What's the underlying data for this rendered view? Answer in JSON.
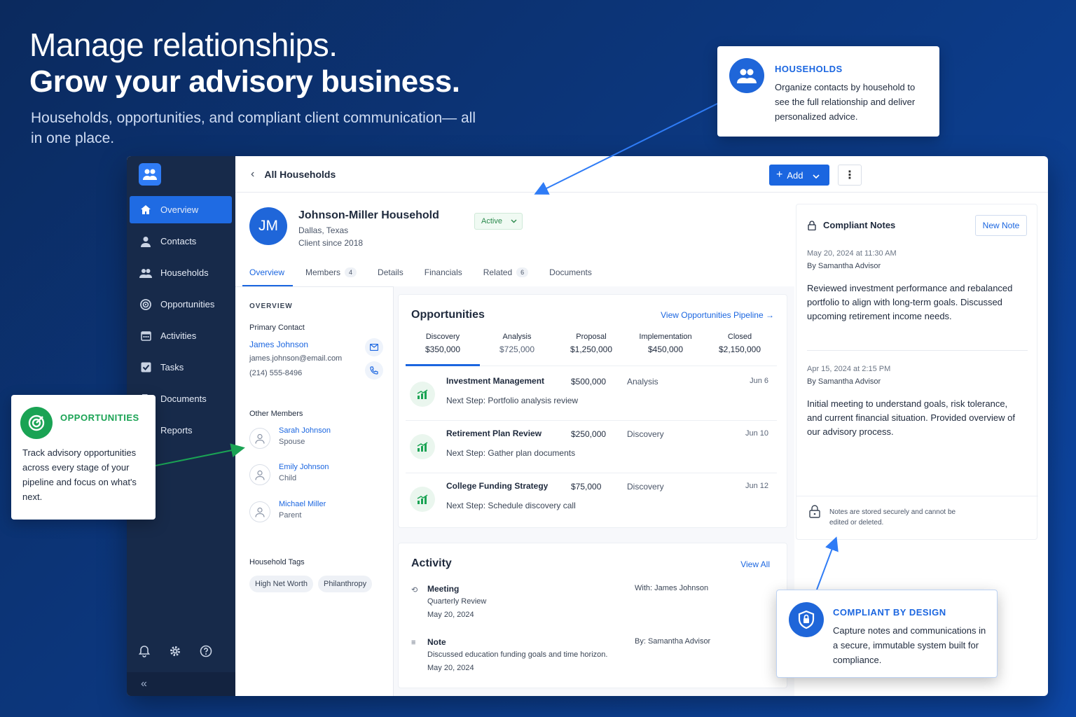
{
  "hero": {
    "line1": "Manage relationships.",
    "line2": "Grow your advisory business.",
    "subtitle": "Households, opportunities, and compliant client communication— all in one place."
  },
  "sidebar": {
    "items": [
      {
        "label": "Overview",
        "icon": "home-icon",
        "active": true
      },
      {
        "label": "Contacts",
        "icon": "person-icon"
      },
      {
        "label": "Households",
        "icon": "people-icon"
      },
      {
        "label": "Opportunities",
        "icon": "target-icon"
      },
      {
        "label": "Activities",
        "icon": "calendar-icon"
      },
      {
        "label": "Tasks",
        "icon": "checkbox-icon"
      },
      {
        "label": "Documents",
        "icon": "document-icon"
      },
      {
        "label": "Reports",
        "icon": "chart-icon"
      }
    ],
    "collapse_glyph": "«"
  },
  "topbar": {
    "breadcrumb": "All Households",
    "add_label": "Add"
  },
  "household": {
    "initials": "JM",
    "name": "Johnson-Miller Household",
    "location": "Dallas, Texas",
    "since": "Client since 2018",
    "status": "Active"
  },
  "tabs": [
    {
      "label": "Overview",
      "active": true
    },
    {
      "label": "Members",
      "badge": "4"
    },
    {
      "label": "Details"
    },
    {
      "label": "Financials"
    },
    {
      "label": "Related",
      "badge": "6"
    },
    {
      "label": "Documents"
    }
  ],
  "overview": {
    "heading": "OVERVIEW",
    "primary_label": "Primary Contact",
    "primary_name": "James Johnson",
    "primary_email": "james.johnson@email.com",
    "primary_phone": "(214) 555-8496",
    "other_members_label": "Other Members",
    "members": [
      {
        "name": "Sarah Johnson",
        "role": "Spouse"
      },
      {
        "name": "Emily Johnson",
        "role": "Child"
      },
      {
        "name": "Michael Miller",
        "role": "Parent"
      }
    ],
    "tags_label": "Household Tags",
    "tags": [
      "High Net Worth",
      "Philanthropy"
    ]
  },
  "opportunities": {
    "title": "Opportunities",
    "pipeline_link": "View Opportunities Pipeline",
    "stages": [
      {
        "name": "Discovery",
        "value": "$350,000"
      },
      {
        "name": "Analysis",
        "value": "$725,000"
      },
      {
        "name": "Proposal",
        "value": "$1,250,000"
      },
      {
        "name": "Implementation",
        "value": "$450,000"
      },
      {
        "name": "Closed",
        "value": "$2,150,000"
      }
    ],
    "rows": [
      {
        "name": "Investment Management",
        "amount": "$500,000",
        "stage": "Analysis",
        "date": "Jun 6",
        "next": "Next Step: Portfolio analysis review"
      },
      {
        "name": "Retirement Plan Review",
        "amount": "$250,000",
        "stage": "Discovery",
        "date": "Jun 10",
        "next": "Next Step: Gather plan documents"
      },
      {
        "name": "College Funding Strategy",
        "amount": "$75,000",
        "stage": "Discovery",
        "date": "Jun 12",
        "next": "Next Step: Schedule discovery call"
      }
    ]
  },
  "activity": {
    "title": "Activity",
    "view_all": "View All",
    "items": [
      {
        "type": "Meeting",
        "line1": "Quarterly Review",
        "line2": "May 20, 2024",
        "with": "With: James Johnson"
      },
      {
        "type": "Note",
        "line1": "Discussed education funding goals and time horizon.",
        "line2": "May 20, 2024",
        "with": "By: Samantha Advisor"
      }
    ]
  },
  "notes": {
    "title": "Compliant Notes",
    "new_note": "New Note",
    "items": [
      {
        "timestamp": "May 20, 2024 at 11:30 AM",
        "author": "By Samantha Advisor",
        "body": "Reviewed investment performance and rebalanced portfolio to align with long-term goals. Discussed upcoming retirement income needs."
      },
      {
        "timestamp": "Apr 15, 2024 at 2:15 PM",
        "author": "By Samantha Advisor",
        "body": "Initial meeting to understand goals, risk tolerance, and current financial situation. Provided overview of our advisory process."
      }
    ],
    "footer": "Notes are stored securely and cannot be edited or deleted."
  },
  "callouts": {
    "households": {
      "title": "HOUSEHOLDS",
      "body": "Organize contacts by household to see the full relationship and deliver personalized advice."
    },
    "opportunities": {
      "title": "OPPORTUNITIES",
      "body": "Track advisory opportunities across every stage of your pipeline and focus on what's next."
    },
    "compliant": {
      "title": "COMPLIANT BY DESIGN",
      "body": "Capture notes and communications in a secure, immutable system built for compliance."
    }
  },
  "colors": {
    "accent": "#1b66e0",
    "sidebar": "#172a4a",
    "green": "#1aa354"
  }
}
